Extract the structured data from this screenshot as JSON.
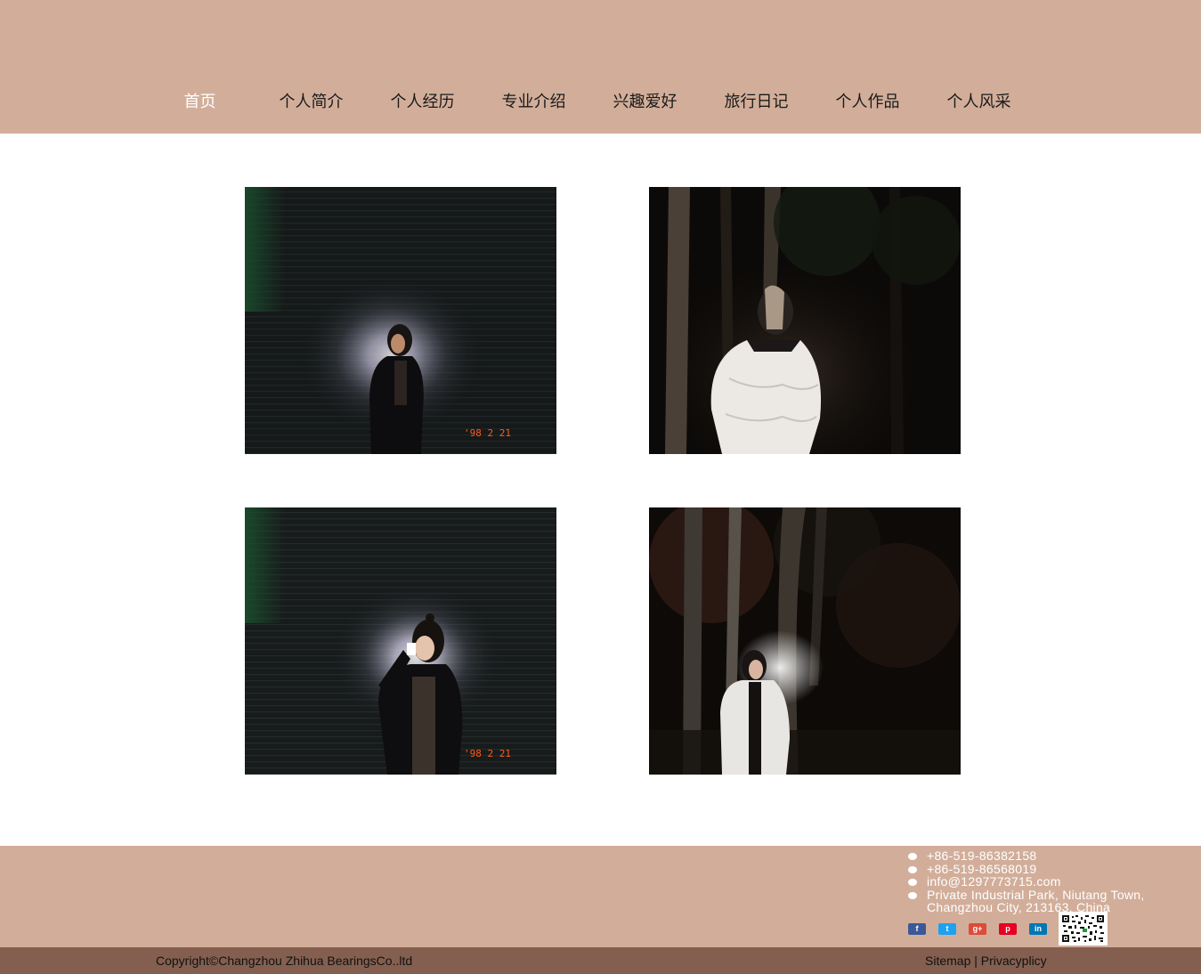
{
  "nav": {
    "items": [
      {
        "label": "首页",
        "active": true
      },
      {
        "label": "个人简介"
      },
      {
        "label": "个人经历"
      },
      {
        "label": "专业介绍"
      },
      {
        "label": "兴趣爱好"
      },
      {
        "label": "旅行日记"
      },
      {
        "label": "个人作品"
      },
      {
        "label": "个人风采"
      }
    ]
  },
  "gallery": {
    "photos": [
      {
        "subject": "portrait-at-shutter-wall",
        "date_stamp": "'98 2 21"
      },
      {
        "subject": "portrait-among-trees"
      },
      {
        "subject": "portrait-with-light-at-shutter-wall",
        "date_stamp": "'98 2 21"
      },
      {
        "subject": "portrait-standing-in-woods"
      }
    ]
  },
  "footer": {
    "contact": {
      "phone1": "+86-519-86382158",
      "phone2": "+86-519-86568019",
      "email": "info@1297773715.com",
      "address_line1": "Private Industrial Park, Niutang Town,",
      "address_line2": "Changzhou City, 213163, China"
    },
    "socials": [
      {
        "name": "facebook-icon",
        "glyph": "f",
        "color": "#3b5998"
      },
      {
        "name": "twitter-icon",
        "glyph": "t",
        "color": "#1da1f2"
      },
      {
        "name": "google-plus-icon",
        "glyph": "g+",
        "color": "#dd4b39"
      },
      {
        "name": "pinterest-icon",
        "glyph": "p",
        "color": "#e60023"
      },
      {
        "name": "linkedin-icon",
        "glyph": "in",
        "color": "#0077b5"
      }
    ],
    "copyright": "Copyright©Changzhou Zhihua BearingsCo..ltd",
    "sitemap": "Sitemap",
    "separator": " | ",
    "privacy": "Privacyplicy"
  },
  "colors": {
    "header_bg": "#d2ae9a",
    "footer_bar": "#845f50",
    "date_stamp": "#ff5a1a"
  }
}
